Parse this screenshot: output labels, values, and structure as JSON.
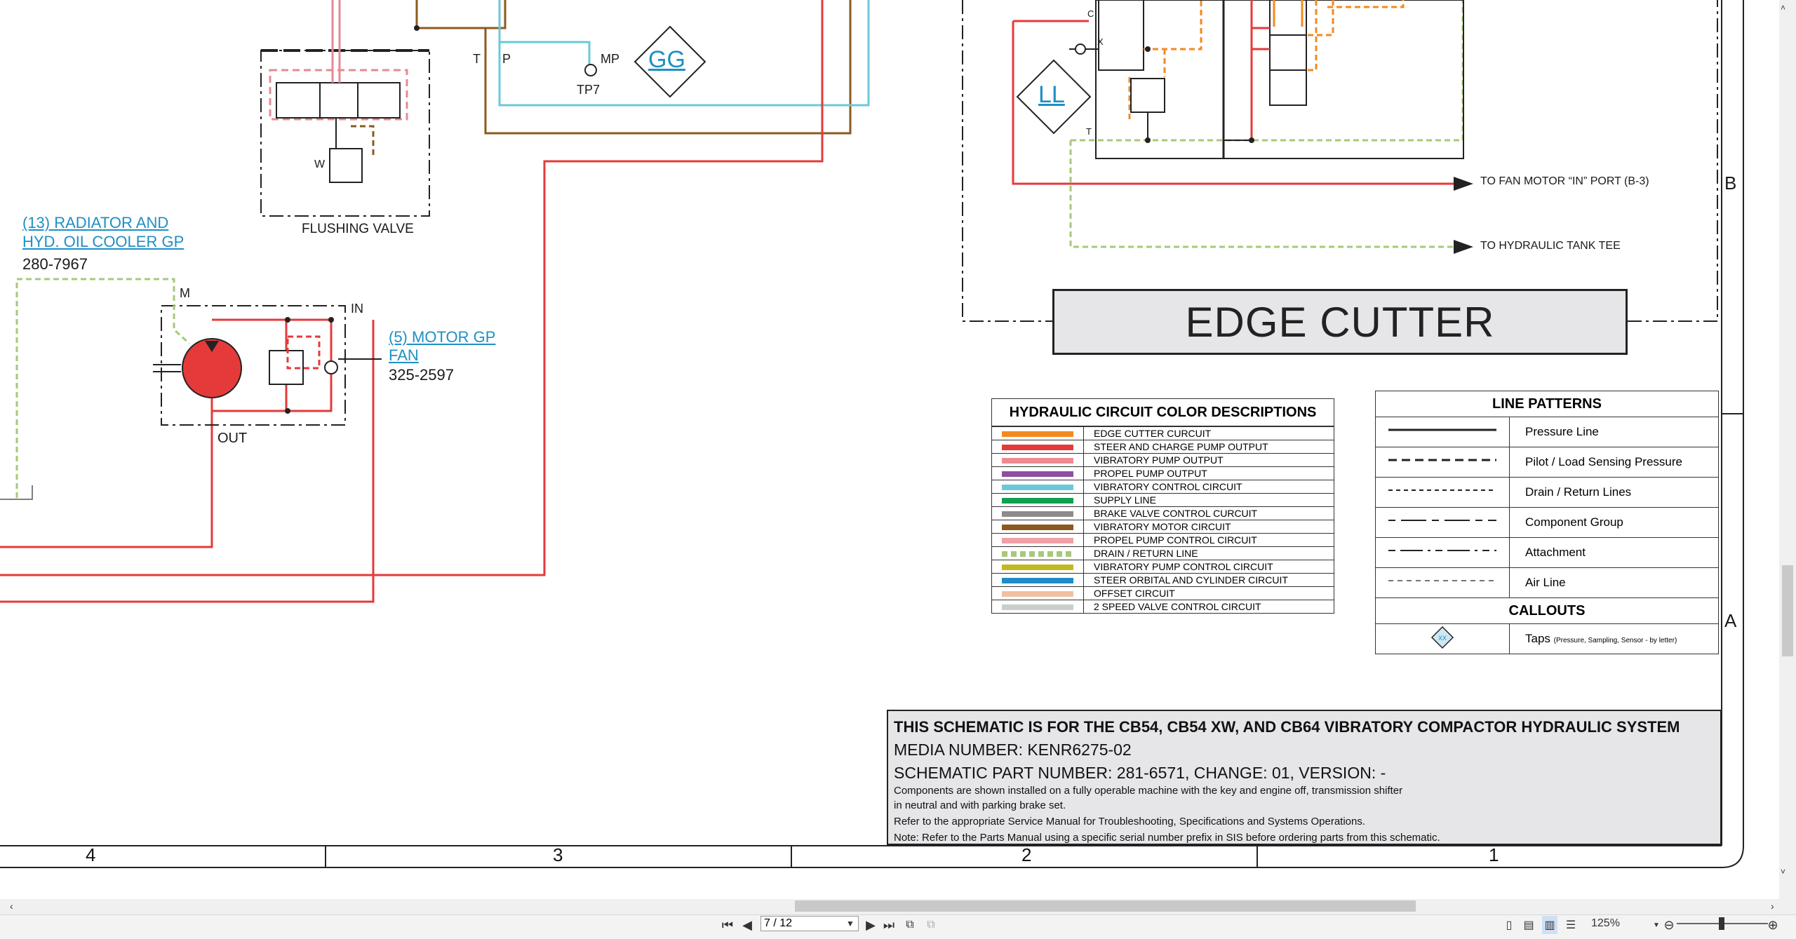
{
  "schematic": {
    "left_labels": {
      "radiator_line1": "(13) RADIATOR AND",
      "radiator_line2": "HYD. OIL COOLER GP",
      "radiator_part": "280-7967",
      "motor_line1": "(5) MOTOR GP",
      "motor_line2": "FAN",
      "motor_part": "325-2597",
      "m_port": "M",
      "in_port": "IN",
      "out_port": "OUT",
      "t_port": "T",
      "p_port": "P",
      "mp_port": "MP",
      "tp7": "TP7",
      "flushing_valve": "FLUSHING VALVE",
      "w_label": "W",
      "gg_tap": "GG",
      "ll_tap": "LL",
      "x_label": "X",
      "c_label": "C",
      "t_label_right": "T"
    },
    "arrows": {
      "fan_motor": "TO FAN MOTOR “IN” PORT (B-3)",
      "tank_tee": "TO HYDRAULIC TANK TEE"
    },
    "edge_cutter_title": "EDGE CUTTER",
    "zone_letters": {
      "b": "B",
      "a": "A"
    },
    "zone_numbers": [
      "4",
      "3",
      "2",
      "1"
    ]
  },
  "color_legend": {
    "title": "HYDRAULIC CIRCUIT COLOR DESCRIPTIONS",
    "items": [
      {
        "color": "#f28a20",
        "label": "EDGE CUTTER CURCUIT"
      },
      {
        "color": "#e53a3a",
        "label": "STEER AND CHARGE PUMP OUTPUT"
      },
      {
        "color": "#ef8a92",
        "label": "VIBRATORY PUMP OUTPUT"
      },
      {
        "color": "#8e4fa0",
        "label": "PROPEL PUMP OUTPUT"
      },
      {
        "color": "#6cc8d8",
        "label": "VIBRATORY CONTROL CIRCUIT"
      },
      {
        "color": "#0fa050",
        "label": "SUPPLY LINE"
      },
      {
        "color": "#8c8c8c",
        "label": "BRAKE VALVE CONTROL CURCUIT"
      },
      {
        "color": "#8c5a1e",
        "label": "VIBRATORY MOTOR CIRCUIT"
      },
      {
        "color": "#f0a0a8",
        "label": "PROPEL PUMP CONTROL CIRCUIT"
      },
      {
        "color": "#a8c87a",
        "label": "DRAIN / RETURN LINE"
      },
      {
        "color": "#c4b820",
        "label": "VIBRATORY PUMP CONTROL CIRCUIT"
      },
      {
        "color": "#1e8cc8",
        "label": "STEER ORBITAL AND CYLINDER CIRCUIT"
      },
      {
        "color": "#f0c0a0",
        "label": "OFFSET CIRCUIT"
      },
      {
        "color": "#c8d0c8",
        "label": "2 SPEED VALVE CONTROL CIRCUIT"
      }
    ]
  },
  "pattern_legend": {
    "title": "LINE PATTERNS",
    "items": [
      {
        "pattern": "solid",
        "label": "Pressure Line"
      },
      {
        "pattern": "dash-long",
        "label": "Pilot / Load Sensing Pressure"
      },
      {
        "pattern": "dash-short",
        "label": "Drain / Return Lines"
      },
      {
        "pattern": "dash-mixed",
        "label": "Component Group"
      },
      {
        "pattern": "dash-dot",
        "label": "Attachment"
      },
      {
        "pattern": "dash-thin",
        "label": "Air Line"
      }
    ],
    "callouts_title": "CALLOUTS",
    "callout_label": "Taps",
    "callout_note": "(Pressure, Sampling, Sensor - by letter)",
    "callout_symbol": "XX"
  },
  "title_block": {
    "line1": "THIS SCHEMATIC IS FOR THE CB54, CB54 XW, AND CB64 VIBRATORY COMPACTOR HYDRAULIC SYSTEM",
    "line2": "MEDIA NUMBER: KENR6275-02",
    "line3": "SCHEMATIC PART NUMBER: 281-6571, CHANGE: 01, VERSION: -",
    "note1": "Components are shown installed on a fully operable machine with the key and engine off, transmission shifter",
    "note2": "in neutral and with parking brake set.",
    "note3": "Refer to the appropriate Service Manual for Troubleshooting, Specifications and Systems Operations.",
    "note4": "Note: Refer to the Parts Manual using a specific serial number prefix in SIS before ordering parts from this schematic."
  },
  "viewer": {
    "page_value": "7 / 12",
    "zoom": "125%",
    "first_icon": "first-page-icon",
    "prev_icon": "prev-page-icon",
    "next_icon": "next-page-icon",
    "last_icon": "last-page-icon"
  }
}
